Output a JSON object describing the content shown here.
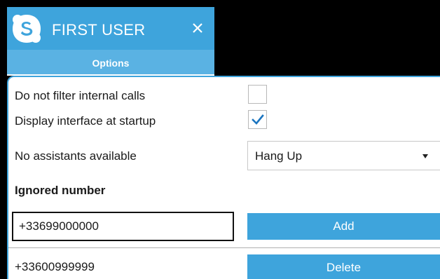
{
  "window": {
    "title": "FIRST USER",
    "close_glyph": "✕",
    "accent_color": "#3ea4dc"
  },
  "tabs": [
    {
      "label": "Options",
      "selected": true
    }
  ],
  "options": {
    "filter_internal_calls": {
      "label": "Do not filter internal calls",
      "checked": false
    },
    "display_at_startup": {
      "label": "Display interface at startup",
      "checked": true
    },
    "no_assistants": {
      "label": "No assistants available",
      "selected_value": "Hang Up"
    }
  },
  "ignored_numbers": {
    "heading": "Ignored number",
    "input_value": "+33699000000",
    "add_label": "Add",
    "delete_label": "Delete",
    "items": [
      "+33600999999"
    ]
  },
  "icons": {
    "app": "skype-logo-icon",
    "close": "close-icon",
    "check": "checkmark-icon",
    "dropdown": "chevron-down-icon"
  }
}
